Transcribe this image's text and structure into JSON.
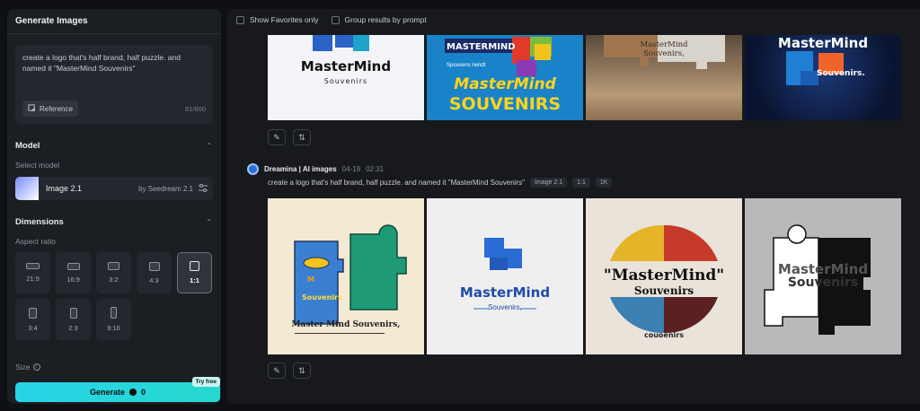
{
  "panel": {
    "title": "Generate Images",
    "prompt": "create a logo that's half brand, half puzzle. and named it \"MasterMind Souvenirs\"",
    "reference_label": "Reference",
    "char_count": "81/800",
    "model_section": "Model",
    "select_model_label": "Select model",
    "model_name": "Image 2.1",
    "model_by": "by Seedream 2.1",
    "dimensions_section": "Dimensions",
    "aspect_label": "Aspect ratio",
    "aspects": [
      "21:9",
      "16:9",
      "3:2",
      "4:3",
      "1:1",
      "3:4",
      "2:3",
      "9:16"
    ],
    "selected_aspect": "1:1",
    "size_label": "Size",
    "generate_label": "Generate",
    "credits": "0",
    "try_free": "Try free"
  },
  "filters": {
    "favorites": "Show Favorites only",
    "group": "Group results by prompt"
  },
  "result": {
    "agent": "Dreamina | AI images",
    "date": "04-19",
    "time": "02:31",
    "prompt": "create a logo that's half brand, half puzzle. and named it \"MasterMind Souvenirs\"",
    "tags": [
      "Image 2.1",
      "1:1",
      "1K"
    ]
  },
  "images_row1": [
    {
      "title": "MasterMind",
      "sub": "Souvenirs"
    },
    {
      "title": "MASTERMIND",
      "sub": "Spouvens nendt",
      "big1": "MasterMind",
      "big2": "SOUVENIRS"
    },
    {
      "title": "MasterMind",
      "sub": "Souvenirs,"
    },
    {
      "title": "MasterMind",
      "sub": "Souvenirs."
    }
  ],
  "images_row2": [
    {
      "title": "Master Mind Souvenirs,",
      "inner": "M",
      "inner2": "Souvenirs"
    },
    {
      "title": "MasterMind",
      "sub": "Souvenirs,"
    },
    {
      "title": "\"MasterMind\"",
      "sub": "Souvenirs",
      "foot": "couoenirs"
    },
    {
      "title": "MasterMind",
      "sub": "Souvenirs"
    }
  ]
}
